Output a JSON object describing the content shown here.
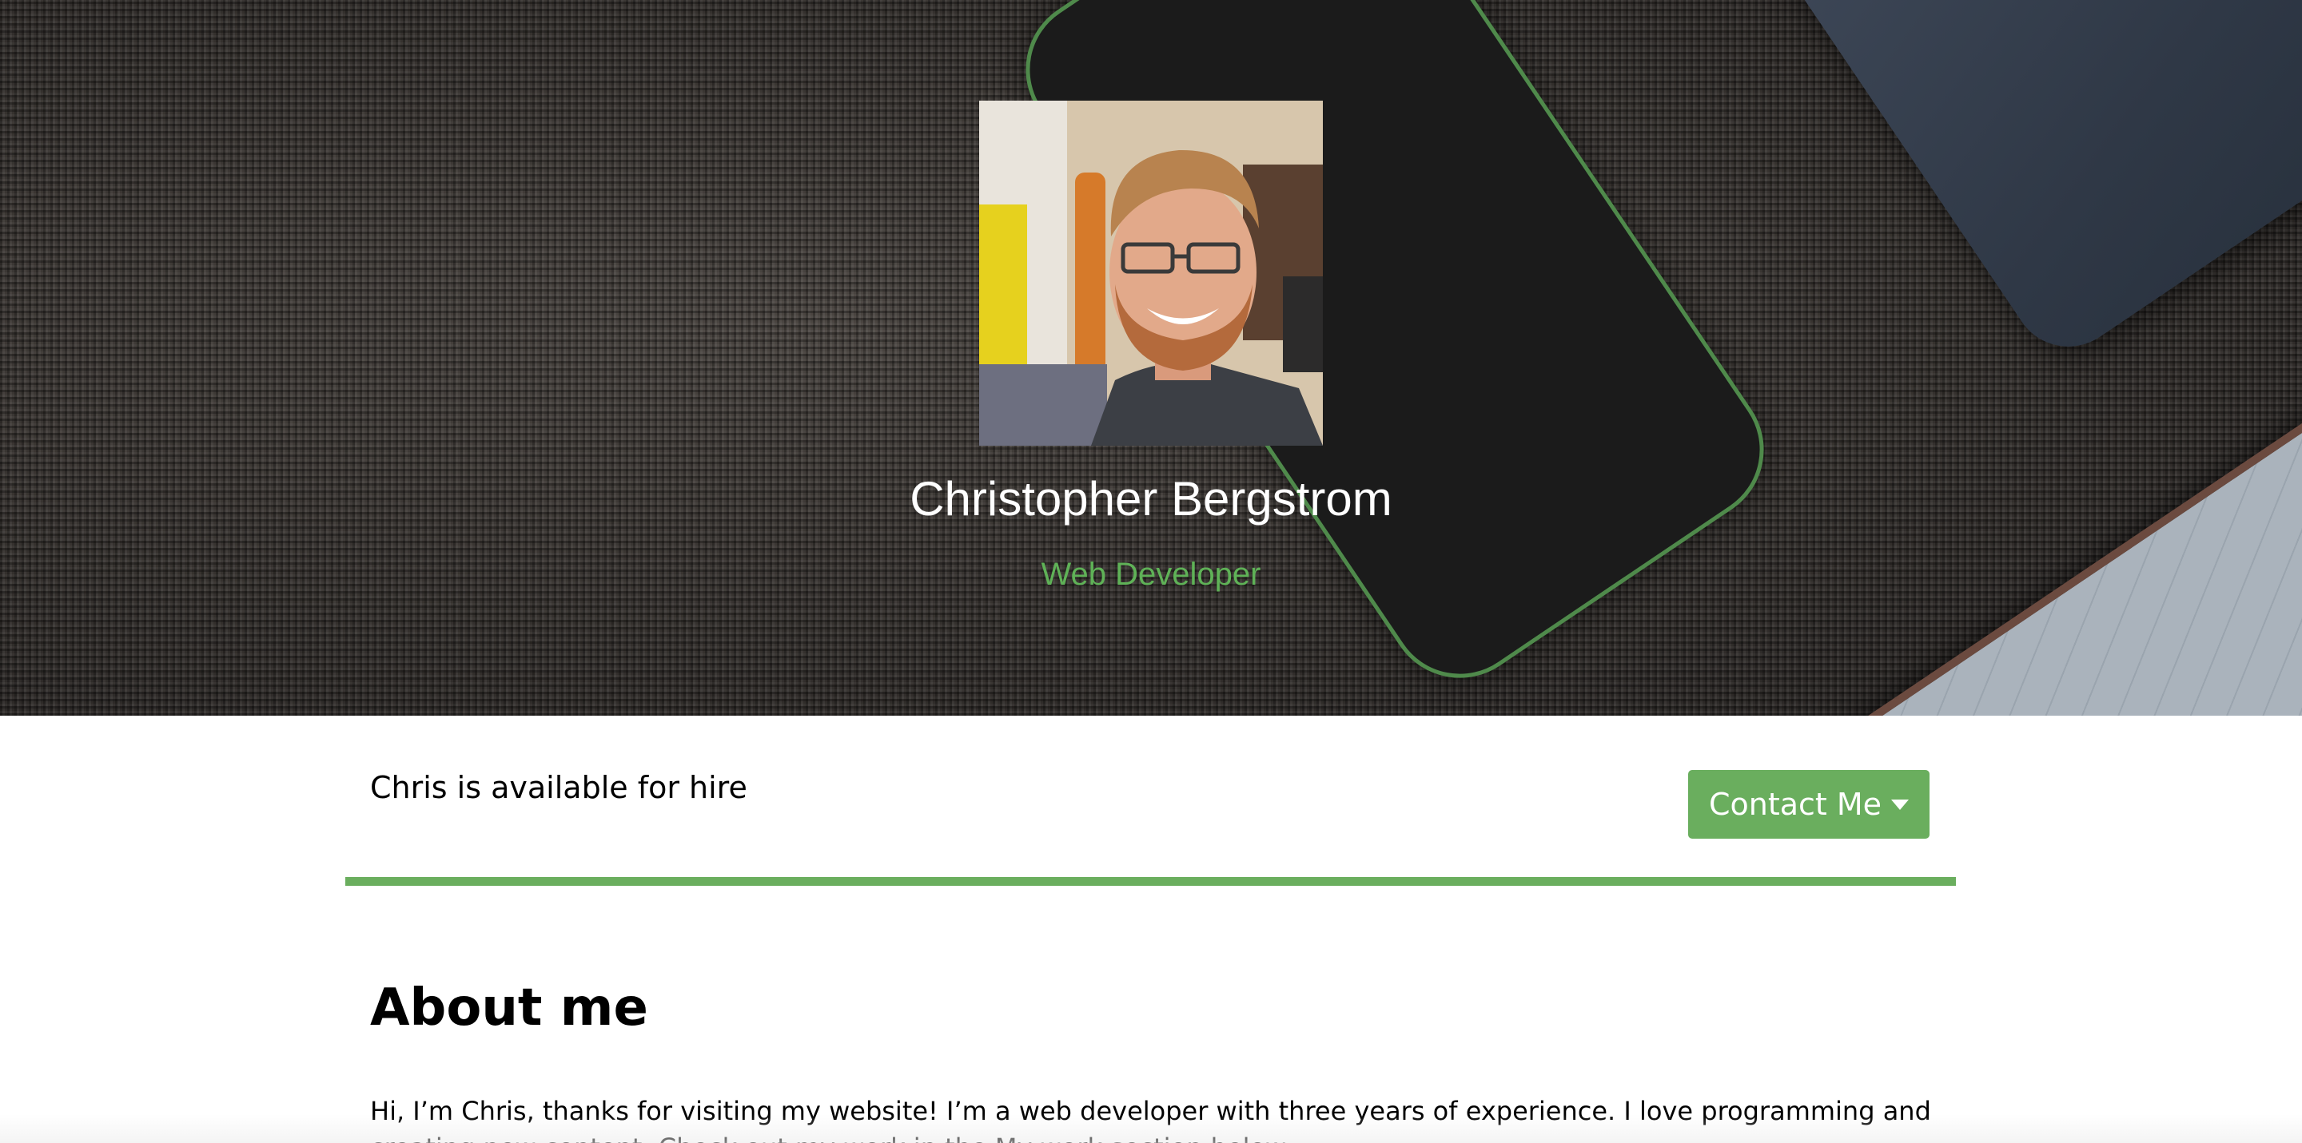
{
  "hero": {
    "name": "Christopher Bergstrom",
    "title": "Web Developer",
    "accent_color": "#5fb257"
  },
  "hire": {
    "text": "Chris is available for hire",
    "contact_button_label": "Contact Me",
    "contact_button_color": "#6aae5e"
  },
  "about": {
    "heading": "About me",
    "paragraph": "Hi, I’m Chris, thanks for visiting my website! I’m a web developer with three years of experience. I love programming and creating new content. Check out my work in the My work section below."
  },
  "icons": {
    "dropdown": "caret-down-icon"
  }
}
